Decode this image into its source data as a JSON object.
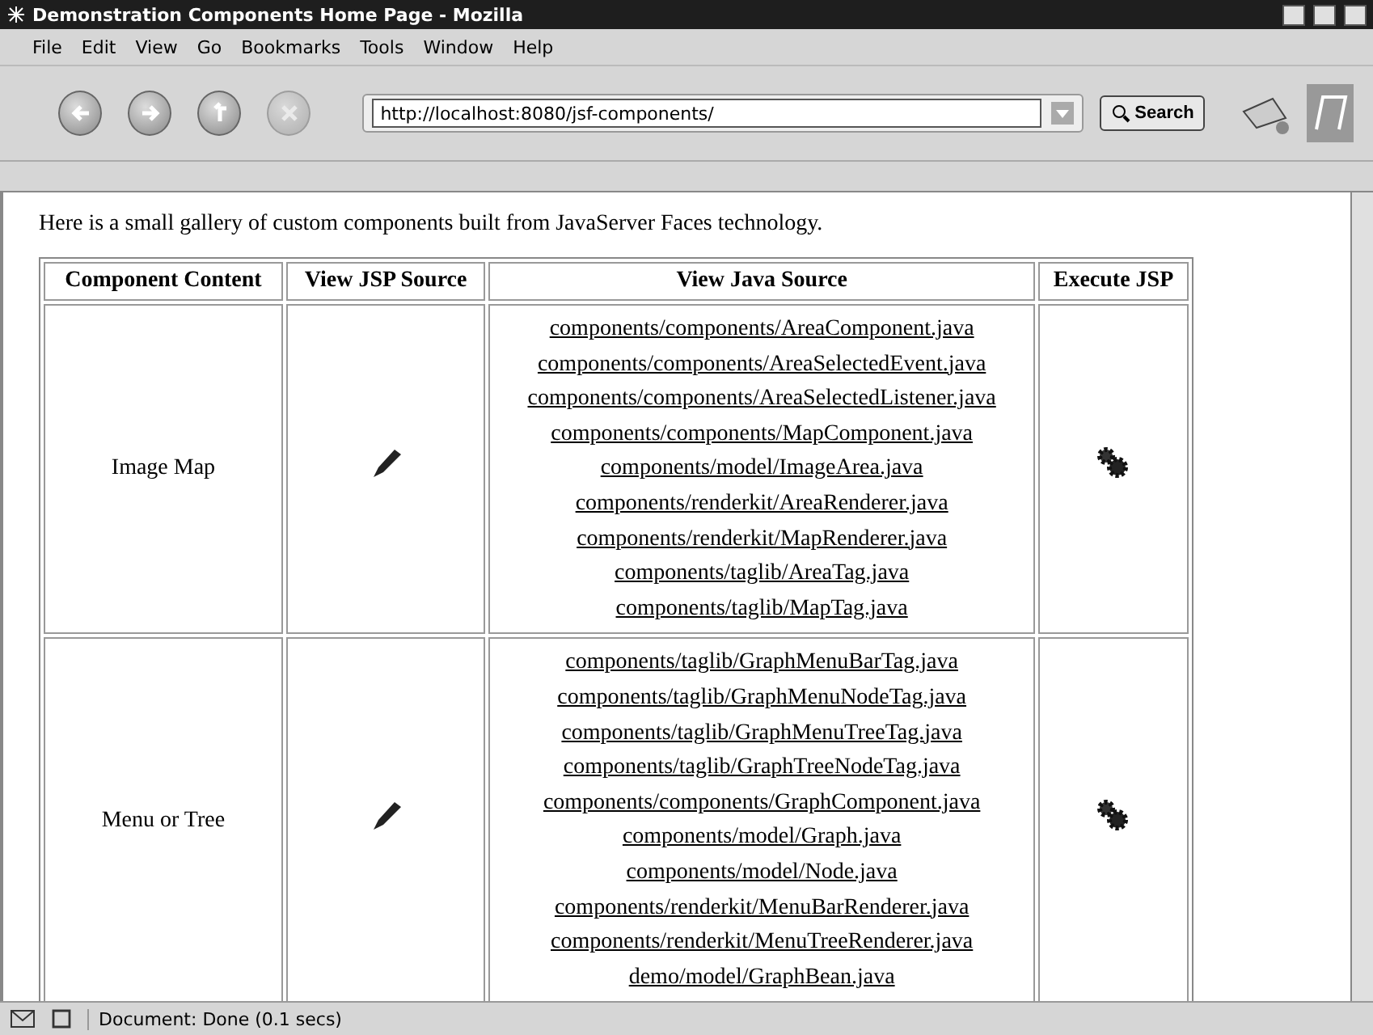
{
  "window": {
    "title": "Demonstration Components Home Page - Mozilla"
  },
  "menu": [
    {
      "label": "File"
    },
    {
      "label": "Edit"
    },
    {
      "label": "View"
    },
    {
      "label": "Go"
    },
    {
      "label": "Bookmarks"
    },
    {
      "label": "Tools"
    },
    {
      "label": "Window"
    },
    {
      "label": "Help"
    }
  ],
  "toolbar": {
    "back_disabled": false,
    "forward_disabled": false,
    "stop_disabled": true,
    "url": "http://localhost:8080/jsf-components/",
    "search_label": "Search"
  },
  "page": {
    "intro": "Here is a small gallery of custom components built from JavaServer Faces technology.",
    "columns": [
      "Component Content",
      "View JSP Source",
      "View Java Source",
      "Execute JSP"
    ],
    "rows": [
      {
        "content": "Image Map",
        "sources": [
          "components/components/AreaComponent.java",
          "components/components/AreaSelectedEvent.java",
          "components/components/AreaSelectedListener.java",
          "components/components/MapComponent.java",
          "components/model/ImageArea.java",
          "components/renderkit/AreaRenderer.java",
          "components/renderkit/MapRenderer.java",
          "components/taglib/AreaTag.java",
          "components/taglib/MapTag.java"
        ]
      },
      {
        "content": "Menu or Tree",
        "sources": [
          "components/taglib/GraphMenuBarTag.java",
          "components/taglib/GraphMenuNodeTag.java",
          "components/taglib/GraphMenuTreeTag.java",
          "components/taglib/GraphTreeNodeTag.java",
          "components/components/GraphComponent.java",
          "components/model/Graph.java",
          "components/model/Node.java",
          "components/renderkit/MenuBarRenderer.java",
          "components/renderkit/MenuTreeRenderer.java",
          "demo/model/GraphBean.java"
        ]
      }
    ]
  },
  "status_bar": {
    "text": "Document: Done (0.1 secs)"
  }
}
